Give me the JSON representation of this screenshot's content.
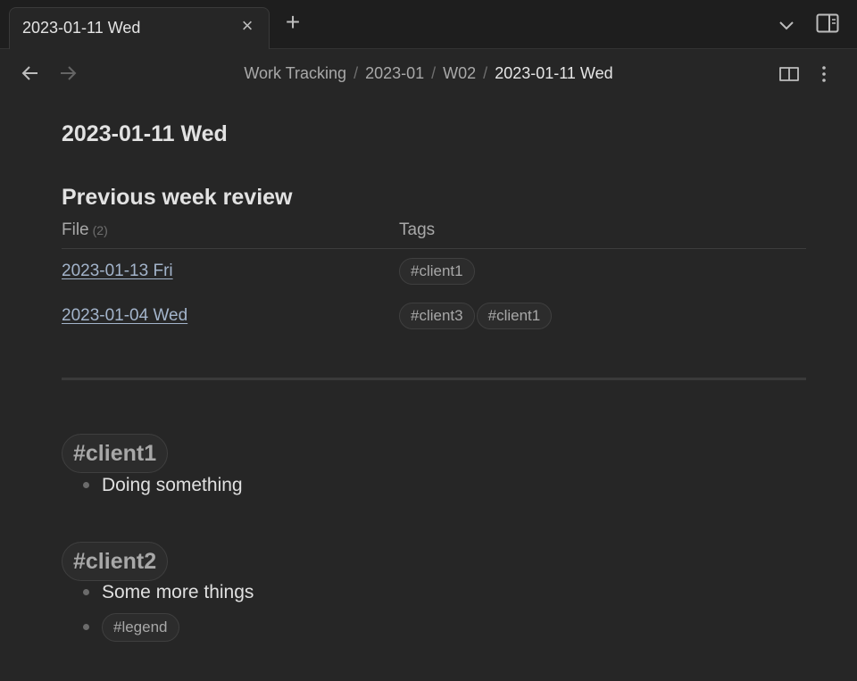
{
  "tab": {
    "title": "2023-01-11 Wed"
  },
  "breadcrumb": {
    "items": [
      "Work Tracking",
      "2023-01",
      "W02"
    ],
    "current": "2023-01-11 Wed",
    "separator": "/"
  },
  "note": {
    "title": "2023-01-11 Wed",
    "review_heading": "Previous week review",
    "table": {
      "headers": {
        "file": "File",
        "file_count": "(2)",
        "tags": "Tags"
      },
      "rows": [
        {
          "file": "2023-01-13 Fri",
          "tags": [
            "#client1"
          ]
        },
        {
          "file": "2023-01-04 Wed",
          "tags": [
            "#client3",
            "#client1"
          ]
        }
      ]
    },
    "sections": [
      {
        "tag": "#client1",
        "bullets": [
          {
            "text": "Doing something"
          }
        ]
      },
      {
        "tag": "#client2",
        "bullets": [
          {
            "text": "Some more things"
          },
          {
            "tag": "#legend"
          }
        ]
      }
    ]
  },
  "icons": {
    "close": "close-icon",
    "new_tab": "plus-icon",
    "tab_list": "chevron-down-icon",
    "sidebar": "sidebar-toggle-icon",
    "back": "arrow-left-icon",
    "forward": "arrow-right-icon",
    "reading": "book-open-icon",
    "more": "more-vertical-icon"
  },
  "colors": {
    "background": "#1e1e1e",
    "pane": "#262626",
    "link": "#a3b4cb",
    "tag_text": "#a8a8a8"
  }
}
